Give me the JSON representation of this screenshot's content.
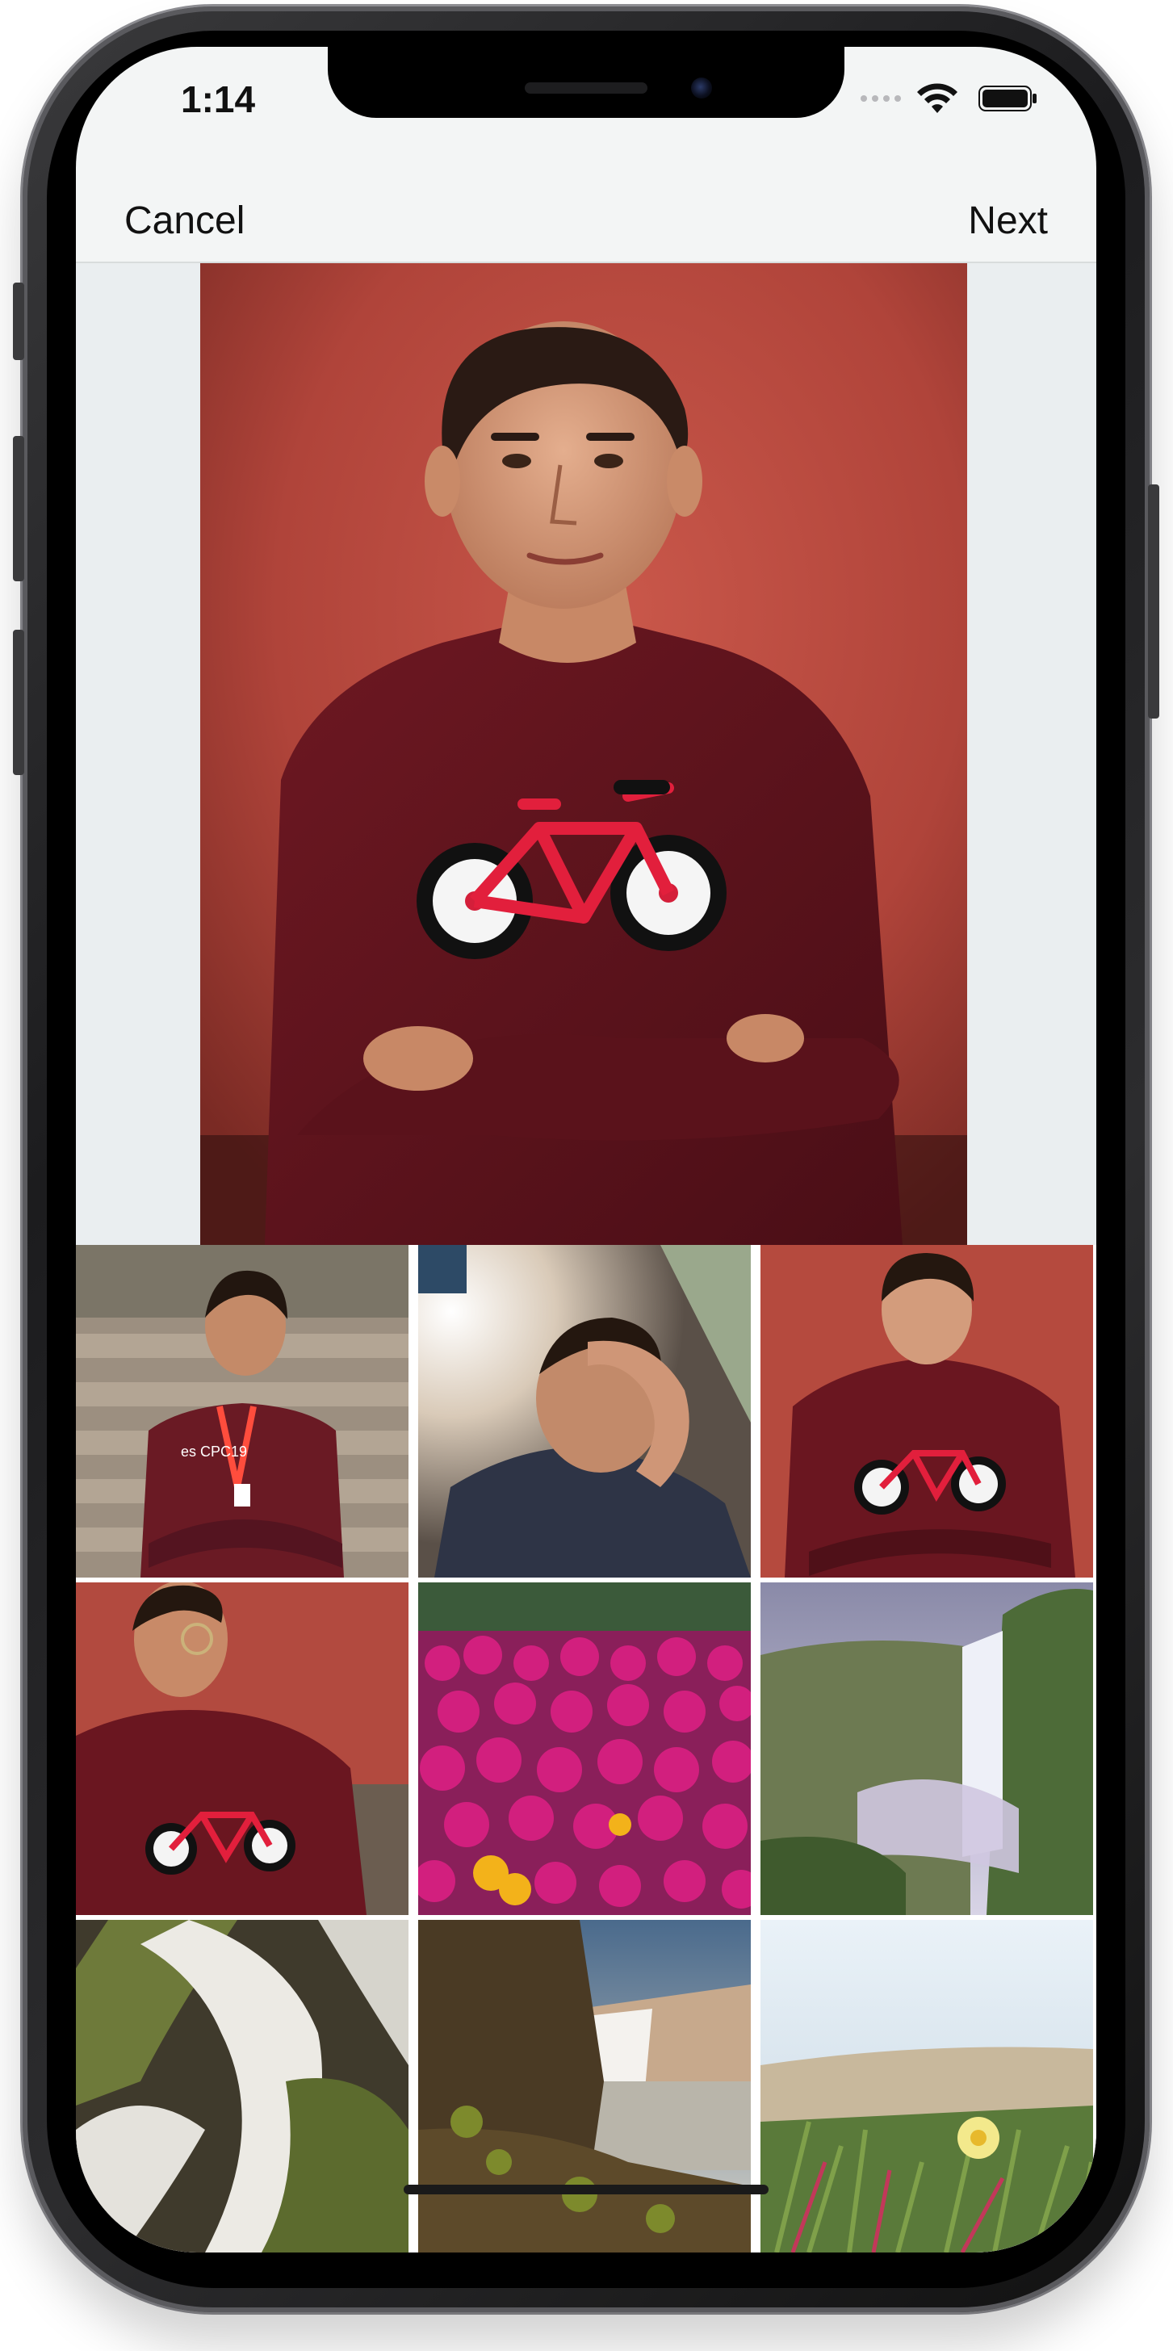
{
  "status_bar": {
    "time": "1:14",
    "signal_icon": "signal-dots-icon",
    "wifi_icon": "wifi-icon",
    "battery_icon": "battery-icon"
  },
  "nav": {
    "cancel_label": "Cancel",
    "next_label": "Next"
  },
  "preview": {
    "subject": "portrait-man-red-wall-bicycle-sweater"
  },
  "grid": {
    "thumbnails": [
      "man-on-steps-lanyard",
      "man-hand-on-face",
      "man-red-wall-bicycle-sweater",
      "man-glasses-looking-up",
      "pink-flowers",
      "waterfall-cliffs",
      "waterfall-rocks-moss",
      "waterfall-coast",
      "yellow-flower-grass"
    ],
    "lanyard_text": "es CPC19"
  },
  "colors": {
    "screen_bg": "#f3f5f5",
    "text": "#111111",
    "wall_red": "#b94a3f",
    "sweater": "#6b1620"
  }
}
